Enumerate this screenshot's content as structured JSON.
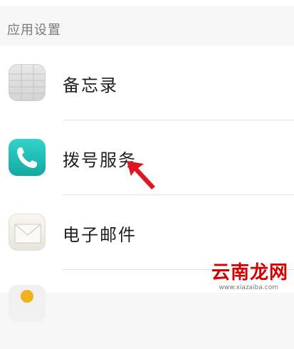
{
  "section": {
    "title": "应用设置"
  },
  "items": [
    {
      "label": "备忘录",
      "icon": "memo-icon"
    },
    {
      "label": "拨号服务",
      "icon": "phone-icon"
    },
    {
      "label": "电子邮件",
      "icon": "mail-icon"
    },
    {
      "label": "",
      "icon": "contact-icon"
    }
  ],
  "annotation": {
    "icon": "red-arrow-icon",
    "color": "#e0151f"
  },
  "watermark": {
    "text": "云南龙网",
    "url": "www.xiazaiba.com"
  }
}
